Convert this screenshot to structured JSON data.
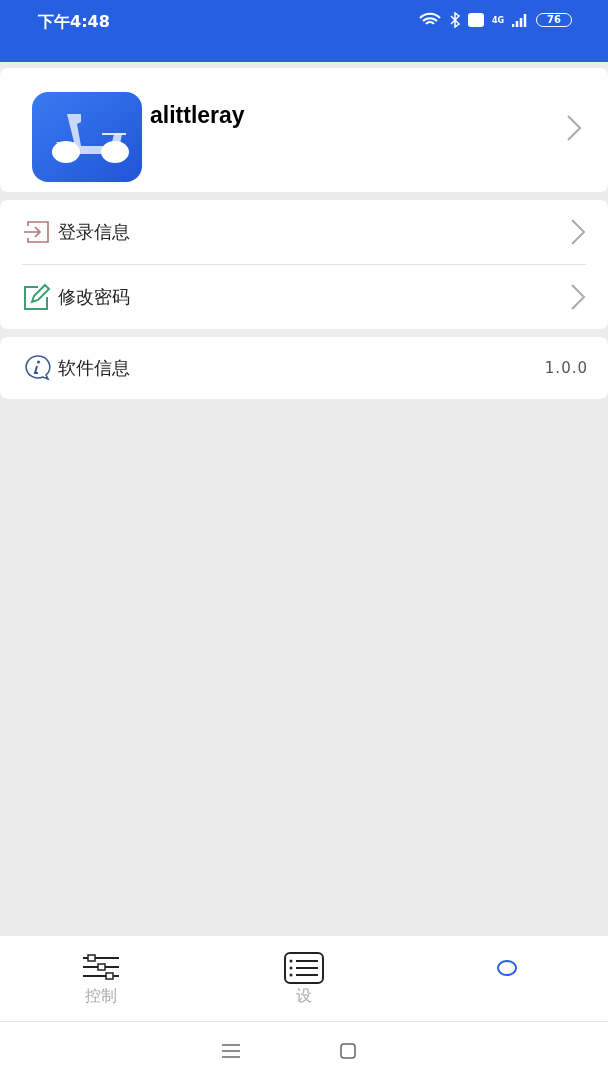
{
  "status_bar": {
    "time": "下午4:48",
    "network": "4G",
    "battery": "76"
  },
  "profile": {
    "name": "alittleray"
  },
  "menu_groups": [
    {
      "items": [
        {
          "kind": "link",
          "label": "登录信息"
        },
        {
          "kind": "link",
          "label": "修改密码"
        }
      ]
    },
    {
      "items": [
        {
          "kind": "info",
          "label": "软件信息",
          "value": "1.0.0"
        }
      ]
    }
  ],
  "tab_bar": [
    {
      "label": "控制",
      "selected": false
    },
    {
      "label": "设",
      "selected": false
    },
    {
      "selected": true
    }
  ]
}
